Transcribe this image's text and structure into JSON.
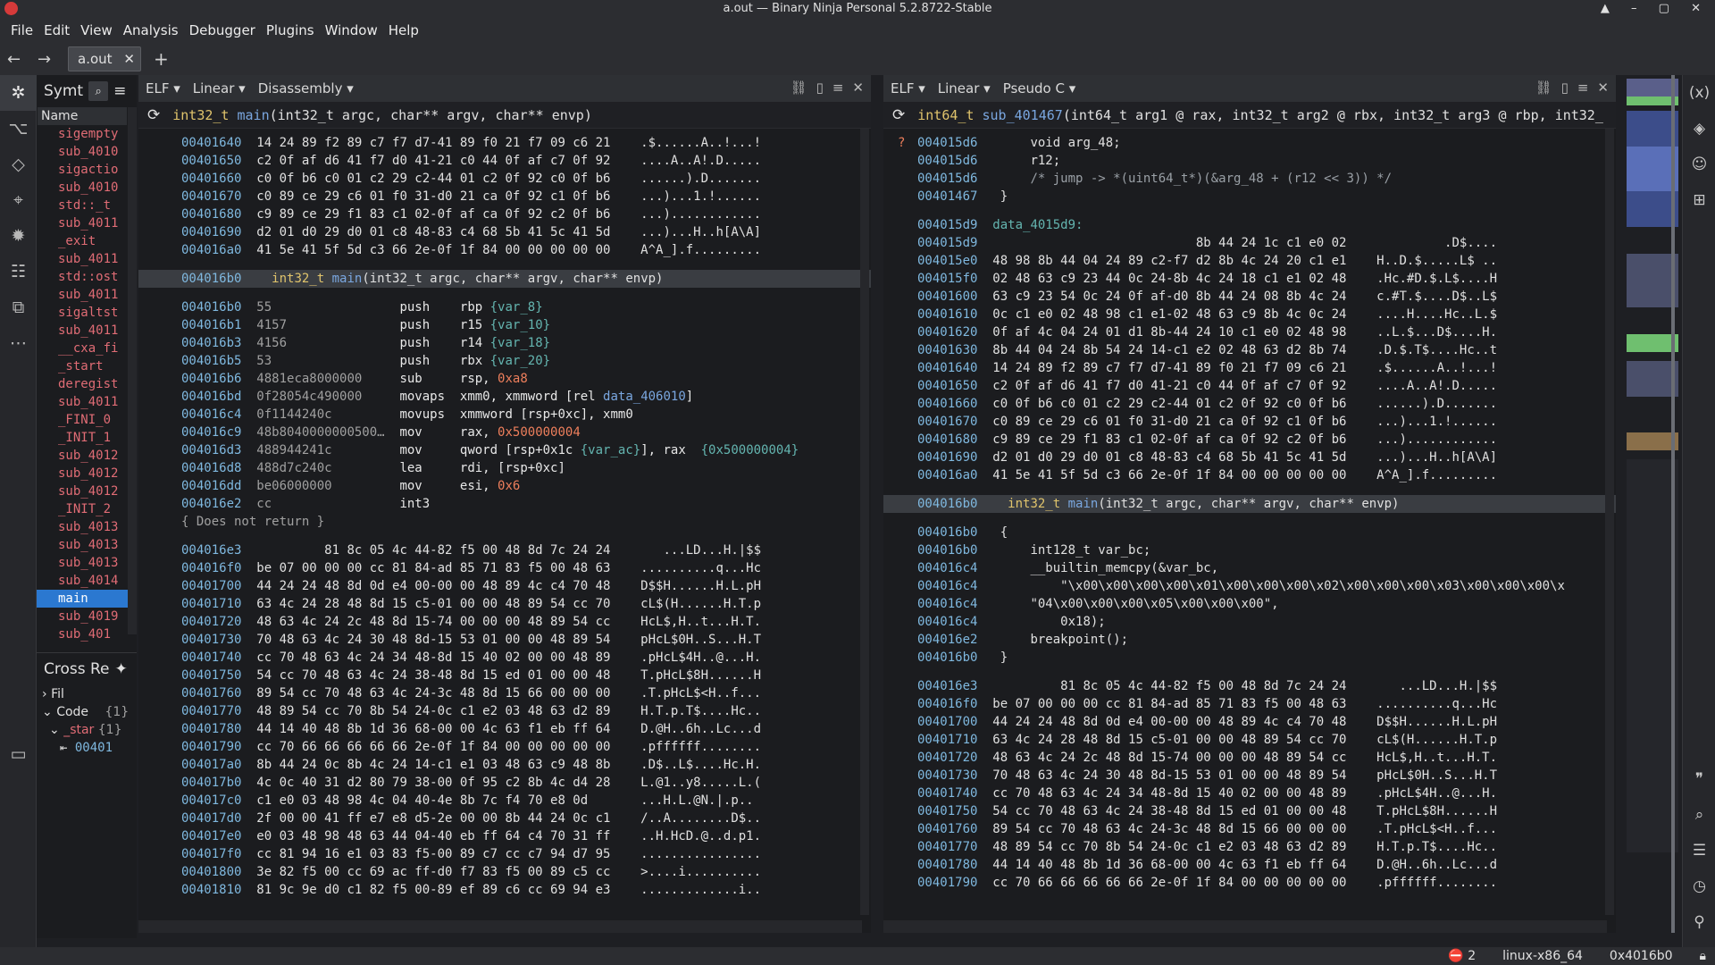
{
  "window": {
    "title": "a.out — Binary Ninja Personal 5.2.8722-Stable",
    "controls": "▲ – ▢ ✕"
  },
  "menu": [
    "File",
    "Edit",
    "View",
    "Analysis",
    "Debugger",
    "Plugins",
    "Window",
    "Help"
  ],
  "tab": {
    "label": "a.out",
    "close": "✕",
    "back": "←",
    "forward": "→",
    "add": "+"
  },
  "symbols": {
    "title": "Symt",
    "column": "Name",
    "items": [
      "sigempty",
      "sub_4010",
      "sigactio",
      "sub_4010",
      "std::_t",
      "sub_4011",
      "_exit",
      "sub_4011",
      "std::ost",
      "sub_4011",
      "sigaltst",
      "sub_4011",
      "__cxa_fi",
      "_start",
      "deregist",
      "sub_4011",
      "_FINI_0",
      "_INIT_1",
      "sub_4012",
      "sub_4012",
      "sub_4012",
      "_INIT_2",
      "sub_4013",
      "sub_4013",
      "sub_4013",
      "sub_4014",
      "main",
      "sub_4019",
      "sub_401"
    ],
    "selected_index": 26
  },
  "xrefs": {
    "title": "Cross Re",
    "filter": "Fil",
    "code": "Code",
    "code_count": "{1}",
    "start": "_star",
    "start_count": "{1}",
    "ref": "00401"
  },
  "left_pane": {
    "header": {
      "format": "ELF ▾",
      "view": "Linear ▾",
      "mode": "Disassembly ▾"
    },
    "func_sig": {
      "ret": "int32_t",
      "name": "main",
      "params": "(int32_t argc, char** argv, char** envp)"
    },
    "hex_top": [
      {
        "a": "00401640",
        "h": "14 24 89 f2 89 c7 f7 d7-41 89 f0 21 f7 09 c6 21",
        "s": ".$......A..!...!"
      },
      {
        "a": "00401650",
        "h": "c2 0f af d6 41 f7 d0 41-21 c0 44 0f af c7 0f 92",
        "s": "....A..A!.D....."
      },
      {
        "a": "00401660",
        "h": "c0 0f b6 c0 01 c2 29 c2-44 01 c2 0f 92 c0 0f b6",
        "s": "......).D......."
      },
      {
        "a": "00401670",
        "h": "c0 89 ce 29 c6 01 f0 31-d0 21 ca 0f 92 c1 0f b6",
        "s": "...)...1.!......"
      },
      {
        "a": "00401680",
        "h": "c9 89 ce 29 f1 83 c1 02-0f af ca 0f 92 c2 0f b6",
        "s": "...)............"
      },
      {
        "a": "00401690",
        "h": "d2 01 d0 29 d0 01 c8 48-83 c4 68 5b 41 5c 41 5d",
        "s": "...)...H..h[A\\A]"
      },
      {
        "a": "004016a0",
        "h": "41 5e 41 5f 5d c3 66 2e-0f 1f 84 00 00 00 00 00",
        "s": "A^A_].f........."
      }
    ],
    "func_header": {
      "addr": "004016b0",
      "ret": "int32_t",
      "name": "main",
      "params": "(int32_t argc, char** argv, char** envp)"
    },
    "disasm": [
      {
        "a": "004016b0",
        "b": "55",
        "m": "push",
        "o": "rbp",
        "v": "{var_8}"
      },
      {
        "a": "004016b1",
        "b": "4157",
        "m": "push",
        "o": "r15",
        "v": "{var_10}"
      },
      {
        "a": "004016b3",
        "b": "4156",
        "m": "push",
        "o": "r14",
        "v": "{var_18}"
      },
      {
        "a": "004016b5",
        "b": "53",
        "m": "push",
        "o": "rbx",
        "v": "{var_20}"
      },
      {
        "a": "004016b6",
        "b": "4881eca8000000",
        "m": "sub",
        "o": "rsp, ",
        "i": "0xa8"
      },
      {
        "a": "004016bd",
        "b": "0f28054c490000",
        "m": "movaps",
        "o": "xmm0, xmmword [rel ",
        "t": "data_406010",
        "e": "]"
      },
      {
        "a": "004016c4",
        "b": "0f1144240c",
        "m": "movups",
        "o": "xmmword [rsp+0xc], xmm0"
      },
      {
        "a": "004016c9",
        "b": "48b8040000000500…",
        "m": "mov",
        "o": "rax, ",
        "i": "0x500000004"
      },
      {
        "a": "004016d3",
        "b": "488944241c",
        "m": "mov",
        "o": "qword [rsp+0x1c ",
        "v": "{var_ac}",
        "e": "], rax  ",
        "i2": "{0x500000004}"
      },
      {
        "a": "004016d8",
        "b": "488d7c240c",
        "m": "lea",
        "o": "rdi, [rsp+0xc]"
      },
      {
        "a": "004016dd",
        "b": "be06000000",
        "m": "mov",
        "o": "esi, ",
        "i": "0x6"
      },
      {
        "a": "004016e2",
        "b": "cc",
        "m": "int3",
        "o": ""
      }
    ],
    "no_return": "{ Does not return }",
    "hex_bottom": [
      {
        "a": "004016e3",
        "h": "         81 8c 05 4c 44-82 f5 00 48 8d 7c 24 24",
        "s": "   ...LD...H.|$$"
      },
      {
        "a": "004016f0",
        "h": "be 07 00 00 00 cc 81 84-ad 85 71 83 f5 00 48 63",
        "s": "..........q...Hc"
      },
      {
        "a": "00401700",
        "h": "44 24 24 48 8d 0d e4 00-00 00 48 89 4c c4 70 48",
        "s": "D$$H......H.L.pH"
      },
      {
        "a": "00401710",
        "h": "63 4c 24 28 48 8d 15 c5-01 00 00 48 89 54 cc 70",
        "s": "cL$(H......H.T.p"
      },
      {
        "a": "00401720",
        "h": "48 63 4c 24 2c 48 8d 15-74 00 00 00 48 89 54 cc",
        "s": "HcL$,H..t...H.T."
      },
      {
        "a": "00401730",
        "h": "70 48 63 4c 24 30 48 8d-15 53 01 00 00 48 89 54",
        "s": "pHcL$0H..S...H.T"
      },
      {
        "a": "00401740",
        "h": "cc 70 48 63 4c 24 34 48-8d 15 40 02 00 00 48 89",
        "s": ".pHcL$4H..@...H."
      },
      {
        "a": "00401750",
        "h": "54 cc 70 48 63 4c 24 38-48 8d 15 ed 01 00 00 48",
        "s": "T.pHcL$8H......H"
      },
      {
        "a": "00401760",
        "h": "89 54 cc 70 48 63 4c 24-3c 48 8d 15 66 00 00 00",
        "s": ".T.pHcL$<H..f..."
      },
      {
        "a": "00401770",
        "h": "48 89 54 cc 70 8b 54 24-0c c1 e2 03 48 63 d2 89",
        "s": "H.T.p.T$....Hc.."
      },
      {
        "a": "00401780",
        "h": "44 14 40 48 8b 1d 36 68-00 00 4c 63 f1 eb ff 64",
        "s": "D.@H..6h..Lc...d"
      },
      {
        "a": "00401790",
        "h": "cc 70 66 66 66 66 66 2e-0f 1f 84 00 00 00 00 00",
        "s": ".pffffff........"
      },
      {
        "a": "004017a0",
        "h": "8b 44 24 0c 8b 4c 24 14-c1 e1 03 48 63 c9 48 8b",
        "s": ".D$..L$....Hc.H."
      },
      {
        "a": "004017b0",
        "h": "4c 0c 40 31 d2 80 79 38-00 0f 95 c2 8b 4c d4 28",
        "s": "L.@1..y8.....L.("
      },
      {
        "a": "004017c0",
        "h": "c1 e0 03 48 98 4c 04 40-4e 8b 7c f4 70 e8 0d",
        "s": "...H.L.@N.|.p.."
      },
      {
        "a": "004017d0",
        "h": "2f 00 00 41 ff e7 e8 d5-2e 00 00 8b 44 24 0c c1",
        "s": "/..A........D$.."
      },
      {
        "a": "004017e0",
        "h": "e0 03 48 98 48 63 44 04-40 eb ff 64 c4 70 31 ff",
        "s": "..H.HcD.@..d.p1."
      },
      {
        "a": "004017f0",
        "h": "cc 81 94 16 e1 03 83 f5-00 89 c7 cc c7 94 d7 95",
        "s": "................"
      },
      {
        "a": "00401800",
        "h": "3e 82 f5 00 cc 69 ac ff-d0 f7 83 f5 00 89 c5 cc",
        "s": ">....i.........."
      },
      {
        "a": "00401810",
        "h": "81 9c 9e d0 c1 82 f5 00-89 ef 89 c6 cc 69 94 e3",
        "s": ".............i.."
      }
    ]
  },
  "right_pane": {
    "header": {
      "format": "ELF ▾",
      "view": "Linear ▾",
      "mode": "Pseudo C ▾"
    },
    "func_sig": {
      "ret": "int64_t",
      "name": "sub_401467",
      "params": "(int64_t arg1 @ rax, int32_t arg2 @ rbx, int32_t arg3 @ rbp, int32_"
    },
    "top_code": [
      {
        "a": "004015d6",
        "c": "    void arg_48;",
        "q": "?"
      },
      {
        "a": "004015d6",
        "c": "    r12;"
      },
      {
        "a": "004015d6",
        "c": "    /* jump -> *(uint64_t*)(&arg_48 + (r12 << 3)) */",
        "cm": true
      },
      {
        "a": "00401467",
        "c": "}"
      }
    ],
    "data_label": {
      "a": "004015d9",
      "name": "data_4015d9:"
    },
    "hex": [
      {
        "a": "004015d9",
        "h": "                           8b 44 24 1c c1 e0 02",
        "s": "         .D$...."
      },
      {
        "a": "004015e0",
        "h": "48 98 8b 44 04 24 89 c2-f7 d2 8b 4c 24 20 c1 e1",
        "s": "H..D.$.....L$ .."
      },
      {
        "a": "004015f0",
        "h": "02 48 63 c9 23 44 0c 24-8b 4c 24 18 c1 e1 02 48",
        "s": ".Hc.#D.$.L$....H"
      },
      {
        "a": "00401600",
        "h": "63 c9 23 54 0c 24 0f af-d0 8b 44 24 08 8b 4c 24",
        "s": "c.#T.$....D$..L$"
      },
      {
        "a": "00401610",
        "h": "0c c1 e0 02 48 98 c1 e1-02 48 63 c9 8b 4c 0c 24",
        "s": "....H....Hc..L.$"
      },
      {
        "a": "00401620",
        "h": "0f af 4c 04 24 01 d1 8b-44 24 10 c1 e0 02 48 98",
        "s": "..L.$...D$....H."
      },
      {
        "a": "00401630",
        "h": "8b 44 04 24 8b 54 24 14-c1 e2 02 48 63 d2 8b 74",
        "s": ".D.$.T$....Hc..t"
      },
      {
        "a": "00401640",
        "h": "14 24 89 f2 89 c7 f7 d7-41 89 f0 21 f7 09 c6 21",
        "s": ".$......A..!...!"
      },
      {
        "a": "00401650",
        "h": "c2 0f af d6 41 f7 d0 41-21 c0 44 0f af c7 0f 92",
        "s": "....A..A!.D....."
      },
      {
        "a": "00401660",
        "h": "c0 0f b6 c0 01 c2 29 c2-44 01 c2 0f 92 c0 0f b6",
        "s": "......).D......."
      },
      {
        "a": "00401670",
        "h": "c0 89 ce 29 c6 01 f0 31-d0 21 ca 0f 92 c1 0f b6",
        "s": "...)...1.!......"
      },
      {
        "a": "00401680",
        "h": "c9 89 ce 29 f1 83 c1 02-0f af ca 0f 92 c2 0f b6",
        "s": "...)............"
      },
      {
        "a": "00401690",
        "h": "d2 01 d0 29 d0 01 c8 48-83 c4 68 5b 41 5c 41 5d",
        "s": "...)...H..h[A\\A]"
      },
      {
        "a": "004016a0",
        "h": "41 5e 41 5f 5d c3 66 2e-0f 1f 84 00 00 00 00 00",
        "s": "A^A_].f........."
      }
    ],
    "func_header": {
      "addr": "004016b0",
      "ret": "int32_t",
      "name": "main",
      "params": "(int32_t argc, char** argv, char** envp)"
    },
    "main_code": [
      {
        "a": "004016b0",
        "c": "{"
      },
      {
        "a": "004016b0",
        "c": "    int128_t var_bc;"
      },
      {
        "a": "004016c4",
        "c": "    __builtin_memcpy(&var_bc,"
      },
      {
        "a": "004016c4",
        "c": "        \"\\x00\\x00\\x00\\x00\\x01\\x00\\x00\\x00\\x02\\x00\\x00\\x00\\x03\\x00\\x00\\x00\\x"
      },
      {
        "a": "004016c4",
        "c": "    \"04\\x00\\x00\\x00\\x05\\x00\\x00\\x00\","
      },
      {
        "a": "004016c4",
        "c": "        0x18);"
      },
      {
        "a": "004016e2",
        "c": "    breakpoint();"
      },
      {
        "a": "004016b0",
        "c": "}"
      }
    ],
    "hex_bottom": [
      {
        "a": "004016e3",
        "h": "         81 8c 05 4c 44-82 f5 00 48 8d 7c 24 24",
        "s": "   ...LD...H.|$$"
      },
      {
        "a": "004016f0",
        "h": "be 07 00 00 00 cc 81 84-ad 85 71 83 f5 00 48 63",
        "s": "..........q...Hc"
      },
      {
        "a": "00401700",
        "h": "44 24 24 48 8d 0d e4 00-00 00 48 89 4c c4 70 48",
        "s": "D$$H......H.L.pH"
      },
      {
        "a": "00401710",
        "h": "63 4c 24 28 48 8d 15 c5-01 00 00 48 89 54 cc 70",
        "s": "cL$(H......H.T.p"
      },
      {
        "a": "00401720",
        "h": "48 63 4c 24 2c 48 8d 15-74 00 00 00 48 89 54 cc",
        "s": "HcL$,H..t...H.T."
      },
      {
        "a": "00401730",
        "h": "70 48 63 4c 24 30 48 8d-15 53 01 00 00 48 89 54",
        "s": "pHcL$0H..S...H.T"
      },
      {
        "a": "00401740",
        "h": "cc 70 48 63 4c 24 34 48-8d 15 40 02 00 00 48 89",
        "s": ".pHcL$4H..@...H."
      },
      {
        "a": "00401750",
        "h": "54 cc 70 48 63 4c 24 38-48 8d 15 ed 01 00 00 48",
        "s": "T.pHcL$8H......H"
      },
      {
        "a": "00401760",
        "h": "89 54 cc 70 48 63 4c 24-3c 48 8d 15 66 00 00 00",
        "s": ".T.pHcL$<H..f..."
      },
      {
        "a": "00401770",
        "h": "48 89 54 cc 70 8b 54 24-0c c1 e2 03 48 63 d2 89",
        "s": "H.T.p.T$....Hc.."
      },
      {
        "a": "00401780",
        "h": "44 14 40 48 8b 1d 36 68-00 00 4c 63 f1 eb ff 64",
        "s": "D.@H..6h..Lc...d"
      },
      {
        "a": "00401790",
        "h": "cc 70 66 66 66 66 66 2e-0f 1f 84 00 00 00 00 00",
        "s": ".pffffff........"
      }
    ]
  },
  "status": {
    "errors": "2",
    "platform": "linux-x86_64",
    "address": "0x4016b0"
  },
  "colors": {
    "accent": "#2b78d0",
    "address": "#7fb8df",
    "immediate": "#ee7f5c",
    "type": "#e0c46c",
    "function": "#7aa7e0",
    "variable": "#64b5b0",
    "symbol": "#e06c75"
  },
  "icons": {
    "left": [
      "graph-icon",
      "types-icon",
      "tags-icon",
      "location-icon",
      "debugger-icon",
      "hierarchy-icon",
      "xref-icon",
      "more-icon",
      "terminal-icon"
    ],
    "right": [
      "variables-icon",
      "layers-icon",
      "robot-icon",
      "grid-icon",
      "quote-icon",
      "search-icon",
      "list-icon",
      "history-icon",
      "pin-icon"
    ]
  }
}
